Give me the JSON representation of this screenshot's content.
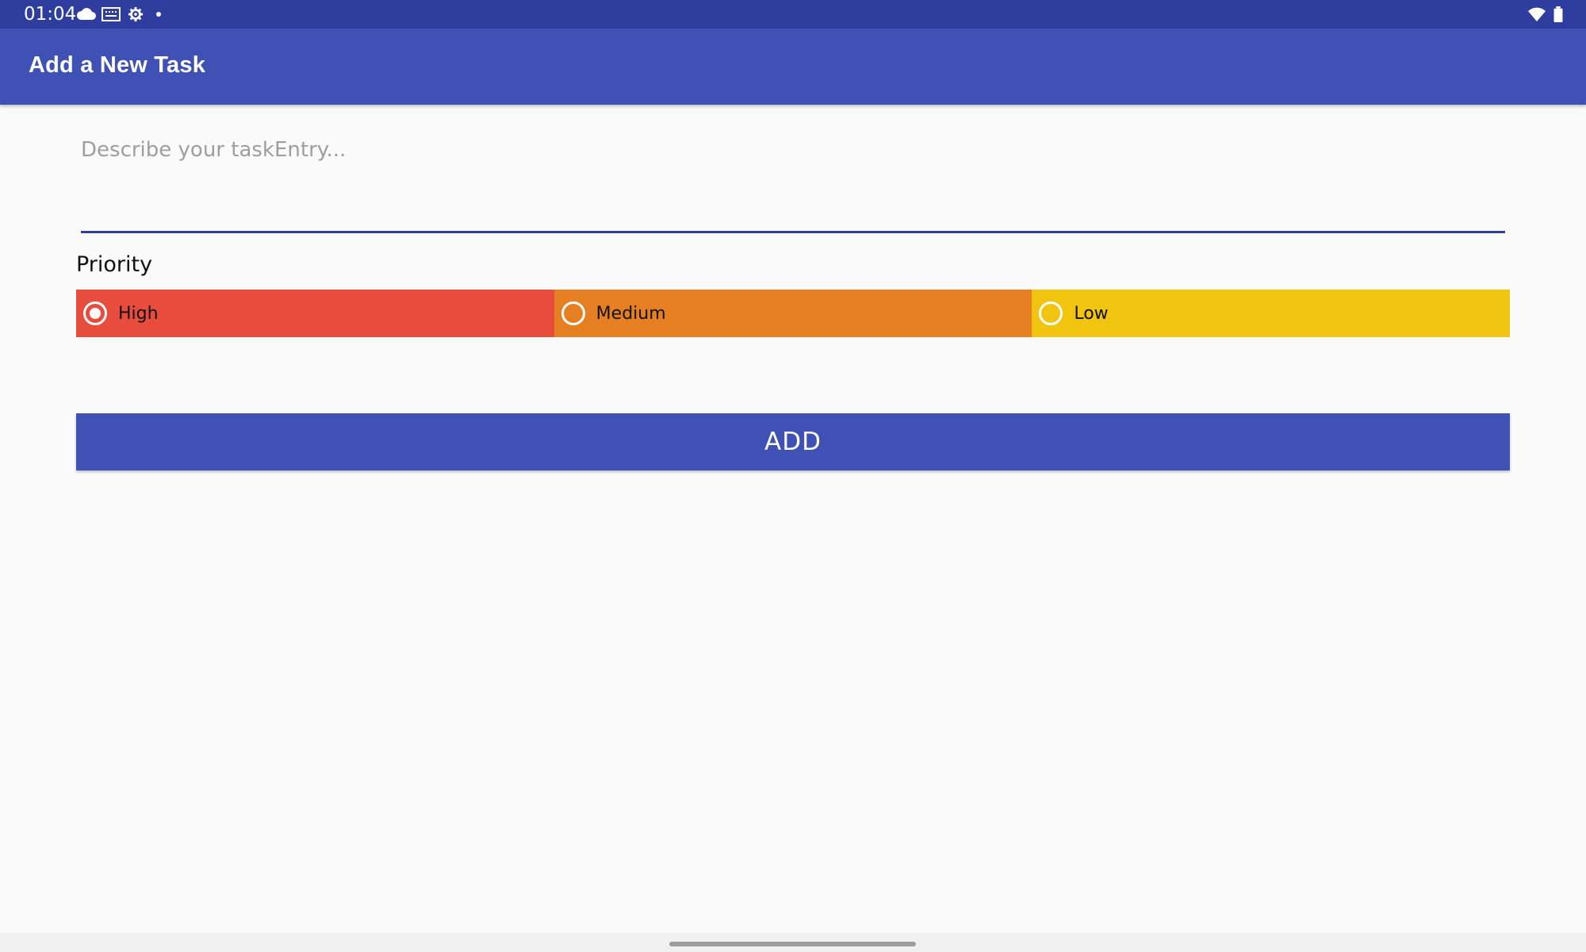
{
  "status_bar": {
    "time": "01:04",
    "left_icons": [
      "cloud-icon",
      "keyboard-icon",
      "settings-gear-icon",
      "notification-dot-icon"
    ],
    "right_icons": [
      "wifi-icon",
      "battery-icon"
    ],
    "color": "#2f3d9e"
  },
  "app_bar": {
    "title": "Add a New Task",
    "color": "#3f51b5"
  },
  "task_input": {
    "placeholder": "Describe your taskEntry...",
    "value": ""
  },
  "priority": {
    "label": "Priority",
    "options": [
      {
        "label": "High",
        "color": "#e74c3c",
        "checked": true
      },
      {
        "label": "Medium",
        "color": "#e67e22",
        "checked": false
      },
      {
        "label": "Low",
        "color": "#f1c40f",
        "checked": false
      }
    ]
  },
  "add_button": {
    "label": "ADD",
    "color": "#3f51b5"
  }
}
